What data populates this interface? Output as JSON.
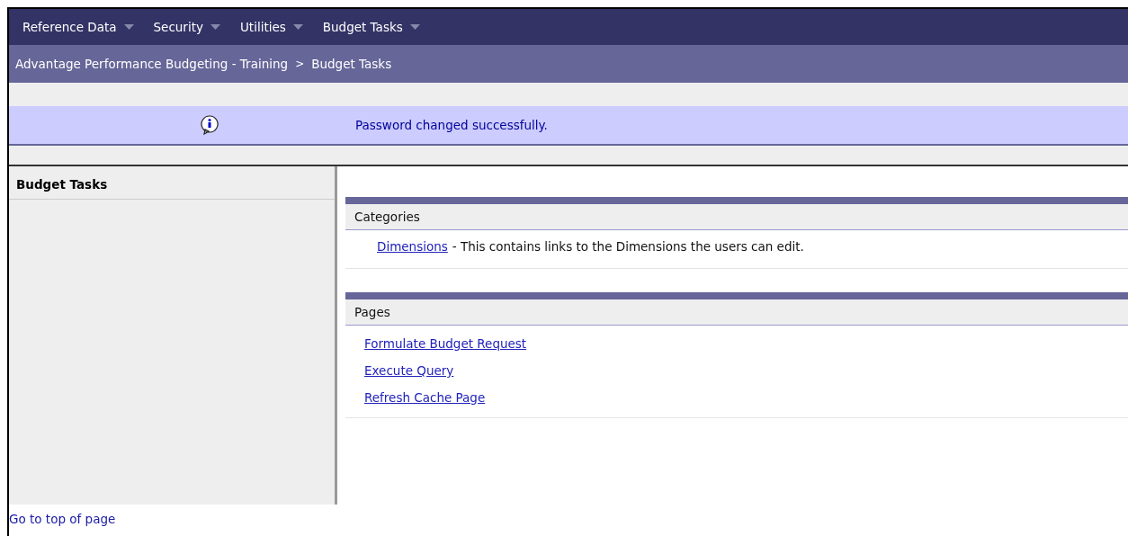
{
  "menu": [
    {
      "label": "Reference Data"
    },
    {
      "label": "Security"
    },
    {
      "label": "Utilities"
    },
    {
      "label": "Budget Tasks"
    }
  ],
  "breadcrumb": [
    {
      "label": "Advantage Performance Budgeting - Training"
    },
    {
      "label": "Budget Tasks"
    }
  ],
  "breadcrumb_separator": ">",
  "message": {
    "text": "Password changed successfully."
  },
  "sidebar": {
    "title": "Budget Tasks"
  },
  "sections": [
    {
      "title": "Categories",
      "items": [
        {
          "kind": "described",
          "link": "Dimensions",
          "description": "- This contains links to the Dimensions the users can edit."
        }
      ]
    },
    {
      "title": "Pages",
      "items": [
        {
          "kind": "plain",
          "link": "Formulate Budget Request"
        },
        {
          "kind": "plain",
          "link": "Execute Query"
        },
        {
          "kind": "plain",
          "link": "Refresh Cache Page"
        }
      ]
    }
  ],
  "footer_link": "Go to top of page"
}
